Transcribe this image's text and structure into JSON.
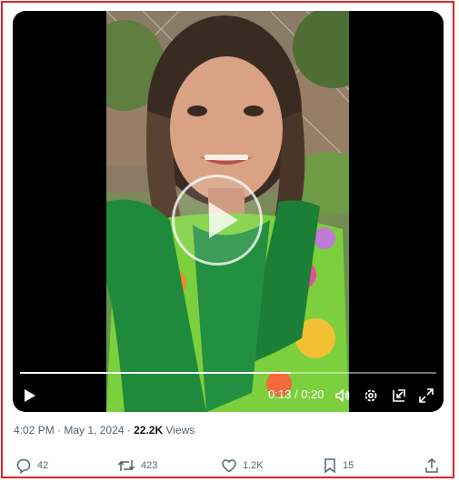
{
  "video": {
    "current_time": "0:13",
    "duration": "0:20",
    "time_separator": "/",
    "progress": 0.65,
    "controls": {
      "play_icon": "play-icon",
      "volume_icon": "volume-icon",
      "settings_icon": "gear-icon",
      "pip_icon": "picture-in-picture-icon",
      "fullscreen_icon": "fullscreen-icon"
    }
  },
  "post_meta": {
    "time": "4:02 PM",
    "separator": "·",
    "date": "May 1, 2024",
    "views_count": "22.2K",
    "views_label": "Views"
  },
  "actions": {
    "replies": "42",
    "reposts": "423",
    "likes": "1.2K",
    "bookmarks": "15"
  },
  "colors": {
    "frame_border": "#e0242a",
    "muted_text": "#536471",
    "primary_text": "#0f1419"
  }
}
